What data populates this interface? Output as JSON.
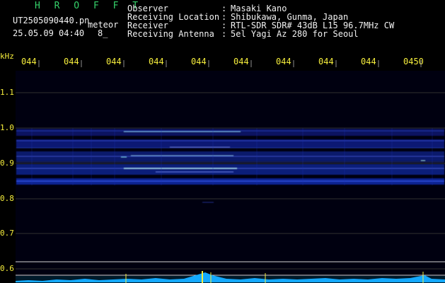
{
  "header": {
    "app_title": "H R O F F T",
    "filename": "UT2505090440.pn",
    "mode": "meteor",
    "datetime": "25.05.09 04:40",
    "counter": "8_",
    "metadata": [
      {
        "label": "Observer",
        "value": "Masaki Kano"
      },
      {
        "label": "Receiving Location",
        "value": "Shibukawa, Gunma, Japan"
      },
      {
        "label": "Receiver",
        "value": "RTL-SDR SDR# 43dB L15 96.7MHz CW"
      },
      {
        "label": "Receiving Antenna",
        "value": "5el Yagi Az 280 for Seoul"
      }
    ],
    "colon": ":"
  },
  "plot": {
    "y_unit": "kHz",
    "y_ticks": [
      "1.1",
      "1.0",
      "0.9",
      "0.8",
      "0.7",
      "0.6"
    ],
    "time_labels": [
      "044",
      "044",
      "044",
      "044",
      "044",
      "044",
      "044",
      "044",
      "044",
      "0450"
    ],
    "colors": {
      "background": "#000010",
      "signal": "#3a5cff",
      "signal_bright": "#9ff3ff",
      "axis_text": "#f6ee3c",
      "spectrum": "#19b7ff"
    }
  }
}
